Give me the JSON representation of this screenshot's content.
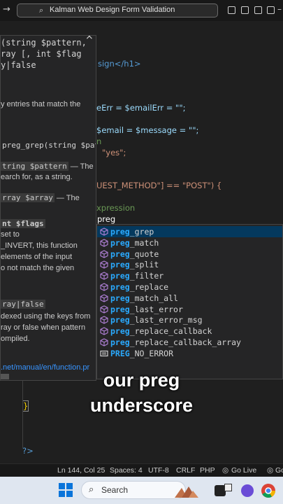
{
  "titlebar": {
    "search_text": "Kalman Web Design Form Validation"
  },
  "hover_doc": {
    "signature_lines": [
      "(string $pattern,",
      "ray [, int $flag",
      "y|false"
    ],
    "desc_lines": [
      "y entries that match the"
    ],
    "example": "preg_grep(string $patt",
    "param1_name": "tring $pattern",
    "param1_desc": [
      "— The",
      "earch for, as a string."
    ],
    "param2_name": "rray $array",
    "param2_desc": " — The",
    "param3_name": "nt $flags",
    "param3_desc": [
      "set to",
      "_INVERT, this function",
      "elements of the input",
      "o not match the given"
    ],
    "return_name": "ray|false",
    "return_desc": [
      "dexed using the keys from",
      "ray or false when pattern",
      "ompiled."
    ],
    "link": ".net/manual/en/function.pr"
  },
  "code": {
    "line_h1": "sign</h1>",
    "line_err": "eErr = $emailErr = \"\";",
    "line_email": "$email = $message = \"\";",
    "line_n": "n",
    "line_yes": "\"yes\";",
    "line_method": "UEST_METHOD\"] == \"POST\") {",
    "line_expr": "xpression",
    "line_typed": "preg",
    "line_brace": "}",
    "line_bracket": "}",
    "line_php_close": "?>"
  },
  "suggestions": [
    {
      "prefix": "preg",
      "rest": "_grep",
      "kind": "function"
    },
    {
      "prefix": "preg",
      "rest": "_match",
      "kind": "function"
    },
    {
      "prefix": "preg",
      "rest": "_quote",
      "kind": "function"
    },
    {
      "prefix": "preg",
      "rest": "_split",
      "kind": "function"
    },
    {
      "prefix": "preg",
      "rest": "_filter",
      "kind": "function"
    },
    {
      "prefix": "preg",
      "rest": "_replace",
      "kind": "function"
    },
    {
      "prefix": "preg",
      "rest": "_match_all",
      "kind": "function"
    },
    {
      "prefix": "preg",
      "rest": "_last_error",
      "kind": "function"
    },
    {
      "prefix": "preg",
      "rest": "_last_error_msg",
      "kind": "function"
    },
    {
      "prefix": "preg",
      "rest": "_replace_callback",
      "kind": "function"
    },
    {
      "prefix": "preg",
      "rest": "_replace_callback_array",
      "kind": "function"
    },
    {
      "prefix": "PREG",
      "rest": "_NO_ERROR",
      "kind": "constant"
    }
  ],
  "caption": {
    "line1": "our preg",
    "line2": "underscore"
  },
  "statusbar": {
    "position": "Ln 144, Col 25",
    "spaces": "Spaces: 4",
    "encoding": "UTF-8",
    "eol": "CRLF",
    "language": "PHP",
    "golive": "Go Live",
    "golive2": "Go"
  },
  "taskbar": {
    "search_label": "Search"
  },
  "colors": {
    "accent": "#2aaaff",
    "selection": "#04395e",
    "link": "#3794ff"
  }
}
